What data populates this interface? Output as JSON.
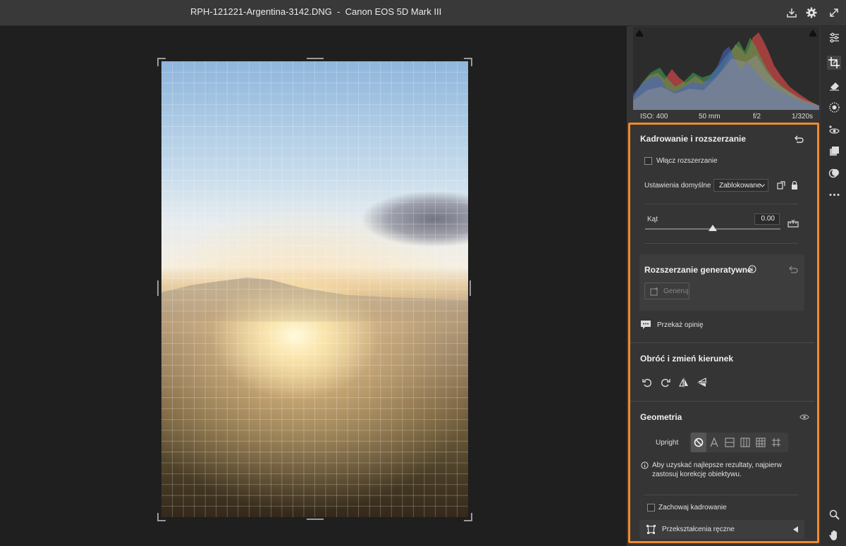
{
  "window": {
    "title": "RPH-121221-Argentina-3142.DNG  -  Canon EOS 5D Mark III"
  },
  "histogram": {
    "iso": "ISO: 400",
    "focal_length": "50 mm",
    "aperture": "f/2",
    "shutter": "1/320s"
  },
  "crop_panel": {
    "title": "Kadrowanie i rozszerzanie",
    "enable_expand_label": "Włącz rozszerzanie",
    "preset_label": "Ustawienia domyślne",
    "preset_value": "Zablokowane",
    "angle_label": "Kąt",
    "angle_value": "0.00",
    "angle_slider_fraction": 0.5
  },
  "generative": {
    "title": "Rozszerzanie generatywne",
    "generate_label": "Generuj"
  },
  "feedback": {
    "label": "Przekaż opinię"
  },
  "rotate": {
    "title": "Obróć i zmień kierunek"
  },
  "geometry": {
    "title": "Geometria",
    "upright_label": "Upright",
    "hint": [
      "Aby uzyskać najlepsze rezultaty, najpierw",
      "zastosuj korekcję obiektywu."
    ],
    "constrain_label": "Zachowaj kadrowanie",
    "manual_label": "Przekształcenia ręczne"
  },
  "colors": {
    "accent_outline": "#f08a2b",
    "panel_bg": "#353535",
    "canvas_bg": "#1f1f1f"
  },
  "icons": [
    "save-icon",
    "settings-icon",
    "fullscreen-icon",
    "edit-sliders-icon",
    "crop-icon",
    "eraser-icon",
    "masking-icon",
    "redeye-icon",
    "presets-icon",
    "snapshot-icon",
    "more-icon",
    "zoom-icon",
    "hand-icon"
  ]
}
